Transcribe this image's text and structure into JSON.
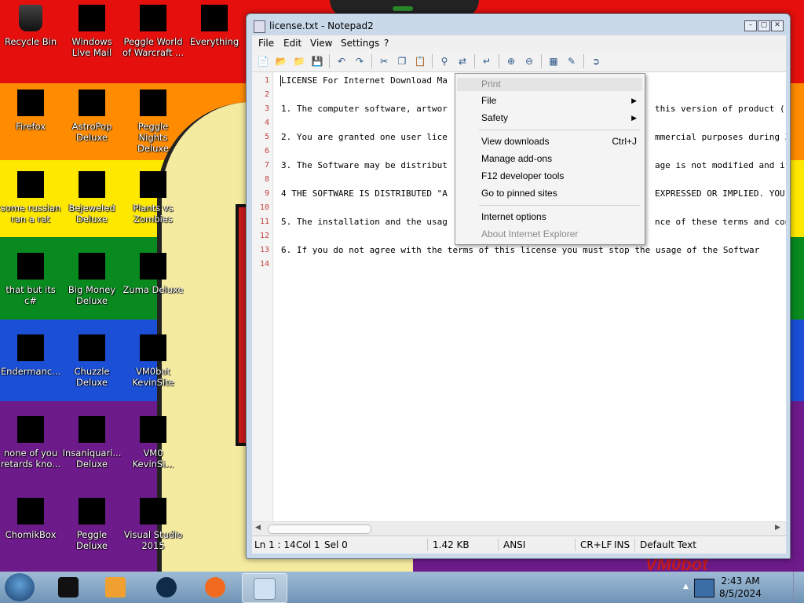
{
  "desktop": {
    "icons": [
      {
        "label": "Recycle Bin"
      },
      {
        "label": "Windows Live Mail"
      },
      {
        "label": "Peggle World of Warcraft ..."
      },
      {
        "label": "Everything"
      },
      {
        "label": "Firefox"
      },
      {
        "label": "AstroPop Deluxe"
      },
      {
        "label": "Peggle Nights Deluxe"
      },
      {
        "label": "some russian ran a rat"
      },
      {
        "label": "Bejeweled Deluxe"
      },
      {
        "label": "Plants vs Zombies"
      },
      {
        "label": "that but its c#"
      },
      {
        "label": "Big Money Deluxe"
      },
      {
        "label": "Zuma Deluxe"
      },
      {
        "label": "Endermanc..."
      },
      {
        "label": "Chuzzle Deluxe"
      },
      {
        "label": "VM0bot KevinSite"
      },
      {
        "label": "none of you retards kno..."
      },
      {
        "label": "Insaniquari... Deluxe"
      },
      {
        "label": "VM0 KevinSi..."
      },
      {
        "label": "ChomikBox"
      },
      {
        "label": "Peggle Deluxe"
      },
      {
        "label": "Visual Studio 2015"
      }
    ],
    "watermark": "VM0bot",
    "colors": {
      "red": "#e5100d",
      "orange": "#ff8c00",
      "yellow": "#ffe800",
      "green": "#088a1f",
      "blue": "#1a4fd6",
      "purple": "#6d1a8a"
    }
  },
  "window": {
    "title": "license.txt - Notepad2",
    "menu": [
      "File",
      "Edit",
      "View",
      "Settings",
      "?"
    ],
    "lines": [
      "LICENSE For Internet Download Ma",
      "",
      "1. The computer software, artwor",
      "",
      "2. You are granted one user lice",
      "",
      "3. The Software may be distribut",
      "",
      "4 THE SOFTWARE IS DISTRIBUTED \"A",
      "",
      "5. The installation and the usag",
      "",
      "6. If you do not agree with the terms of this license you must stop the usage of the Softwar",
      ""
    ],
    "lines_right": [
      "",
      "",
      "this version of product (",
      "",
      "mmercial purposes during 3",
      "",
      "age is not modified and if",
      "",
      "EXPRESSED OR IMPLIED. YOU",
      "",
      "nce of these terms and con",
      "",
      "",
      ""
    ],
    "line_numbers": [
      "1",
      "2",
      "3",
      "4",
      "5",
      "6",
      "7",
      "8",
      "9",
      "10",
      "11",
      "12",
      "13",
      "14"
    ],
    "status": {
      "position": "Ln 1 : 14",
      "col": "Col 1",
      "sel": "Sel 0",
      "size": "1.42 KB",
      "encoding": "ANSI",
      "eol": "CR+LF",
      "mode": "INS",
      "scheme": "Default Text"
    }
  },
  "context_menu": {
    "items": [
      {
        "label": "Print",
        "disabled": true
      },
      {
        "label": "File",
        "submenu": true
      },
      {
        "label": "Safety",
        "submenu": true
      },
      {
        "label": "View downloads",
        "shortcut": "Ctrl+J"
      },
      {
        "label": "Manage add-ons"
      },
      {
        "label": "F12 developer tools"
      },
      {
        "label": "Go to pinned sites"
      },
      {
        "label": "Internet options"
      },
      {
        "label": "About Internet Explorer",
        "disabled": true
      }
    ]
  },
  "taskbar": {
    "clock_time": "2:43 AM",
    "clock_date": "8/5/2024"
  }
}
